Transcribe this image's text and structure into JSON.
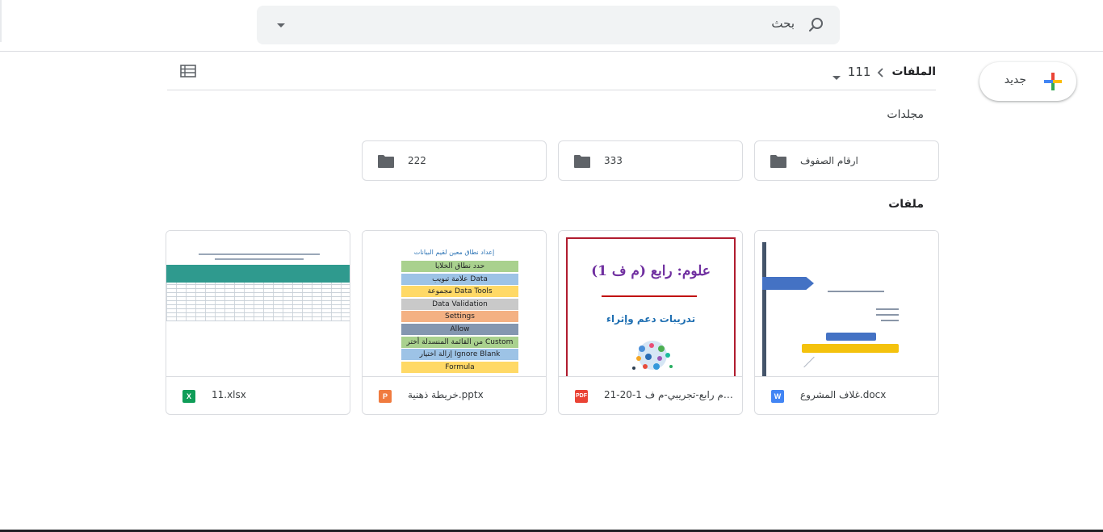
{
  "search": {
    "placeholder": "بحث",
    "dropdown_icon": "arrow-drop-down-icon",
    "icon": "search-icon"
  },
  "new_button": {
    "label": "جديد",
    "icon": "colored-plus-icon"
  },
  "breadcrumb": {
    "root": "الملفات",
    "separator_icon": "chevron-right-icon",
    "current": "111",
    "caret_icon": "arrow-drop-down-icon"
  },
  "view_toggle": {
    "icon": "list-view-icon"
  },
  "sections": {
    "folders": "مجلدات",
    "files": "ملفات"
  },
  "folders": [
    {
      "name": "ارقام الصفوف",
      "icon": "folder-icon"
    },
    {
      "name": "333",
      "icon": "folder-icon"
    },
    {
      "name": "222",
      "icon": "folder-icon"
    }
  ],
  "files": [
    {
      "name": "غلاف المشروع.docx",
      "type_label": "W",
      "type_color": "#4285f4",
      "icon": "docs-icon"
    },
    {
      "name": "علوم رابع-تجريبي-م ف 1-20-21...",
      "type_label": "PDF",
      "type_color": "#ea4335",
      "icon": "pdf-icon"
    },
    {
      "name": "خريطة ذهنية.pptx",
      "type_label": "P",
      "type_color": "#f07b3f",
      "icon": "slides-icon"
    },
    {
      "name": "11.xlsx",
      "type_label": "X",
      "type_color": "#0f9d58",
      "icon": "sheets-icon"
    }
  ],
  "pdf_preview": {
    "title": "علوم: رابع (م ف 1)",
    "subtitle": "تدريبات دعم وإثراء"
  },
  "pptx_preview": {
    "title": "إعداد نطاق معين لقيم البيانات",
    "rows": [
      {
        "text": "حدد نطاق الخلايا",
        "color": "#a9d18e"
      },
      {
        "text": "علامة تبويب Data",
        "color": "#9dc3e6"
      },
      {
        "text": "مجموعة Data Tools",
        "color": "#ffd966"
      },
      {
        "text": "Data Validation",
        "color": "#c9c9c9"
      },
      {
        "text": "Settings",
        "color": "#f4b183"
      },
      {
        "text": "Allow",
        "color": "#8497b0"
      },
      {
        "text": "من القائمة المنسدلة أختر Custom",
        "color": "#a9d18e"
      },
      {
        "text": "إزالة اختيار Ignore Blank",
        "color": "#9dc3e6"
      },
      {
        "text": "Formula",
        "color": "#ffd966"
      }
    ]
  }
}
